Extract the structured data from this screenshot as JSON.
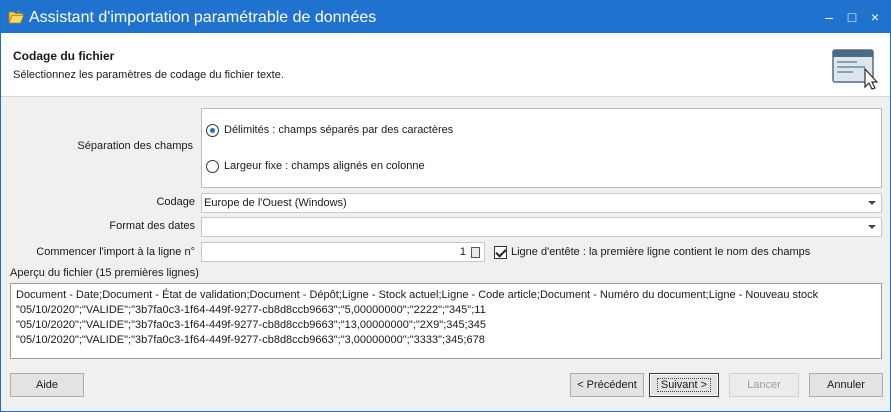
{
  "window": {
    "title": "Assistant d'importation paramétrable de données",
    "controls": {
      "minimize": "–",
      "maximize": "□",
      "close": "×"
    }
  },
  "header": {
    "title": "Codage du fichier",
    "subtitle": "Sélectionnez les paramètres de codage du fichier texte."
  },
  "form": {
    "separation_label": "Séparation des champs",
    "radio_delimited": "Délimités : champs séparés par des caractères",
    "radio_fixed": "Largeur fixe : champs alignés en colonne",
    "radio_delimited_checked": true,
    "codage_label": "Codage",
    "codage_value": "Europe de l'Ouest (Windows)",
    "format_label": "Format des dates",
    "format_value": "",
    "start_label": "Commencer l'import à la ligne n°",
    "start_value": "1",
    "header_checkbox_label": "Ligne d'entête : la première ligne contient le nom des champs",
    "header_checkbox_checked": true
  },
  "preview": {
    "label": "Aperçu du fichier (15 premières lignes)",
    "lines": [
      "Document - Date;Document - État de validation;Document - Dépôt;Ligne - Stock actuel;Ligne - Code article;Document - Numéro du document;Ligne - Nouveau stock",
      "\"05/10/2020\";\"VALIDE\";\"3b7fa0c3-1f64-449f-9277-cb8d8ccb9663\";\"5,00000000\";\"2222\";\"345\";11",
      "\"05/10/2020\";\"VALIDE\";\"3b7fa0c3-1f64-449f-9277-cb8d8ccb9663\";\"13,00000000\";\"2X9\";345;345",
      "\"05/10/2020\";\"VALIDE\";\"3b7fa0c3-1f64-449f-9277-cb8d8ccb9663\";\"3,00000000\";\"3333\";345;678"
    ]
  },
  "buttons": {
    "help": "Aide",
    "previous": "< Précédent",
    "next": "Suivant >",
    "start": "Lancer",
    "cancel": "Annuler"
  },
  "colors": {
    "titlebar": "#1f73cf",
    "accent": "#1f73cf"
  }
}
